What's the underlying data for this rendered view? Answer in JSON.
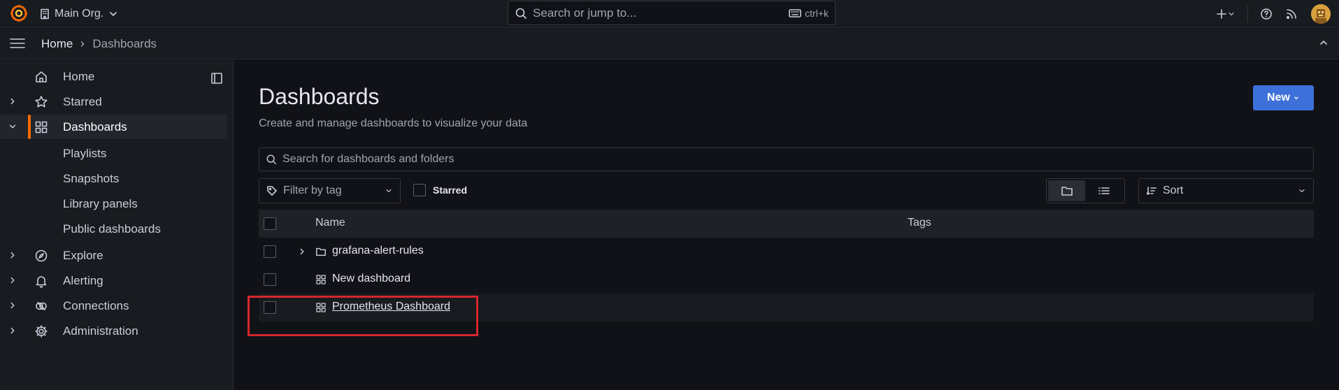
{
  "topbar": {
    "org_name": "Main Org.",
    "search_placeholder": "Search or jump to...",
    "search_shortcut": "ctrl+k"
  },
  "breadcrumb": {
    "home": "Home",
    "current": "Dashboards"
  },
  "sidebar": {
    "items": [
      {
        "label": "Home"
      },
      {
        "label": "Starred"
      },
      {
        "label": "Dashboards"
      },
      {
        "label": "Explore"
      },
      {
        "label": "Alerting"
      },
      {
        "label": "Connections"
      },
      {
        "label": "Administration"
      }
    ],
    "dashboards_children": [
      {
        "label": "Playlists"
      },
      {
        "label": "Snapshots"
      },
      {
        "label": "Library panels"
      },
      {
        "label": "Public dashboards"
      }
    ]
  },
  "main": {
    "title": "Dashboards",
    "subtitle": "Create and manage dashboards to visualize your data",
    "new_button": "New",
    "search_placeholder": "Search for dashboards and folders",
    "filter_placeholder": "Filter by tag",
    "starred_label": "Starred",
    "sort_label": "Sort",
    "columns": {
      "name": "Name",
      "tags": "Tags"
    },
    "rows": [
      {
        "name": "grafana-alert-rules",
        "type": "folder"
      },
      {
        "name": "New dashboard",
        "type": "dashboard"
      },
      {
        "name": "Prometheus Dashboard",
        "type": "dashboard"
      }
    ]
  },
  "colors": {
    "accent_orange": "#f46800",
    "primary_blue": "#3d71d9",
    "highlight_red": "#d6262c"
  }
}
